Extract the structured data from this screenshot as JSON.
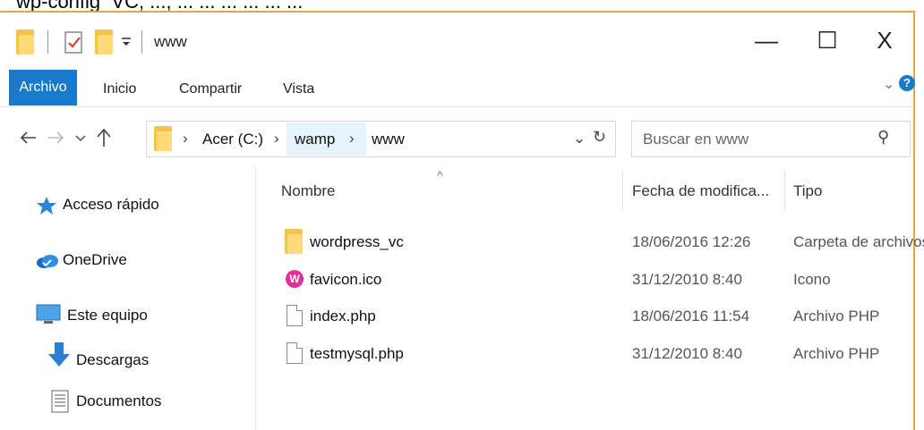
{
  "top_strip_text": "wp-config_VC; ...; ... ... ... ... ... ...",
  "window": {
    "title": "www",
    "minimize": "—",
    "maximize": "☐",
    "close": "X"
  },
  "ribbon": {
    "tabs": [
      "Archivo",
      "Inicio",
      "Compartir",
      "Vista"
    ],
    "expand": "⌄",
    "help": "?"
  },
  "address": {
    "crumbs": [
      "Acer (C:)",
      "wamp",
      "www"
    ],
    "dropdown": "⌄",
    "refresh": "↻"
  },
  "search": {
    "placeholder": "Buscar en www",
    "icon": "⚲"
  },
  "sort_indicator": "^",
  "nav_pane": [
    {
      "label": "Acceso rápido",
      "icon": "star-icon"
    },
    {
      "label": "OneDrive",
      "icon": "cloud-icon"
    },
    {
      "label": "Este equipo",
      "icon": "monitor-icon"
    },
    {
      "label": "Descargas",
      "icon": "download-arrow-icon"
    },
    {
      "label": "Documentos",
      "icon": "document-icon"
    }
  ],
  "columns": {
    "name": "Nombre",
    "date": "Fecha de modifica...",
    "type": "Tipo"
  },
  "files": [
    {
      "name": "wordpress_vc",
      "date": "18/06/2016 12:26",
      "type": "Carpeta de archivos",
      "icon": "folder-icon"
    },
    {
      "name": "favicon.ico",
      "date": "31/12/2010 8:40",
      "type": "Icono",
      "icon": "wamp-icon"
    },
    {
      "name": "index.php",
      "date": "18/06/2016 11:54",
      "type": "Archivo PHP",
      "icon": "file-icon"
    },
    {
      "name": "testmysql.php",
      "date": "31/12/2010 8:40",
      "type": "Archivo PHP",
      "icon": "file-icon"
    }
  ],
  "colors": {
    "accent": "#1979ca",
    "folder": "#f4c24f",
    "frame": "#e3a93a"
  }
}
